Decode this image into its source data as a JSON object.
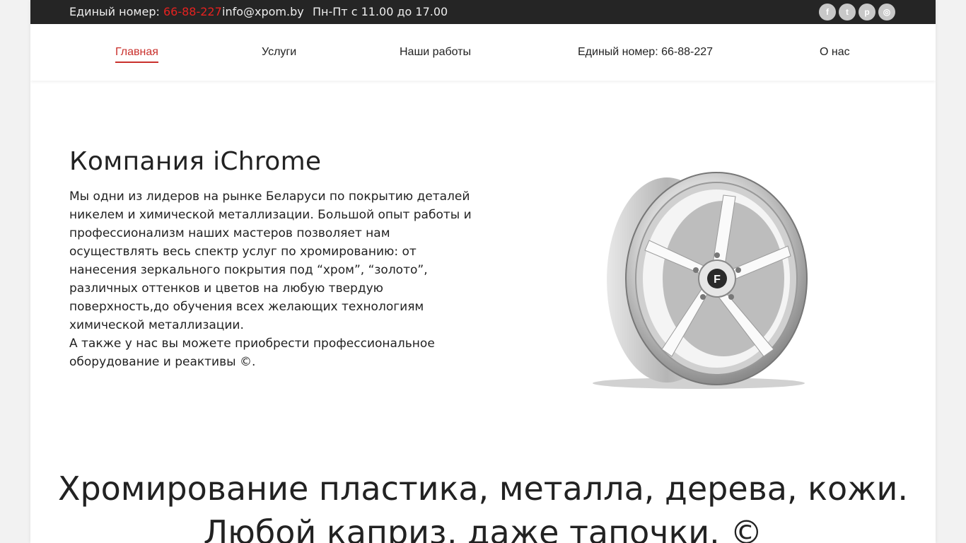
{
  "topbar": {
    "phone_label": "Единый номер:",
    "phone_number": "66-88-227",
    "email": "info@xpom.by",
    "hours": "Пн-Пт с 11.00 до 17.00",
    "social": [
      {
        "icon": "facebook-icon",
        "glyph": "f"
      },
      {
        "icon": "twitter-icon",
        "glyph": "t"
      },
      {
        "icon": "pinterest-icon",
        "glyph": "p"
      },
      {
        "icon": "instagram-icon",
        "glyph": "◎"
      }
    ]
  },
  "nav": {
    "items": [
      {
        "label": "Главная",
        "active": true
      },
      {
        "label": "Услуги"
      },
      {
        "label": "Наши работы"
      },
      {
        "label": "Единый номер: 66-88-227"
      },
      {
        "label": "О нас"
      }
    ]
  },
  "main": {
    "title": "Компания iChrome",
    "paragraph1": "Мы одни из лидеров на рынке Беларуси по покрытию деталей никелем и химической металлизации. Большой опыт работы и профессионализм наших мастеров позволяет нам осуществлять весь спектр услуг по хромированию: от нанесения зеркального покрытия под “хром”, “золото”, различных оттенков и цветов на любую твердую поверхность,до обучения всех желающих технологиям химической металлизации.",
    "paragraph2": "А также у нас вы можете приобрести профессиональное оборудование и реактивы ©.",
    "image_logo_letter": "F"
  },
  "tagline": {
    "line1": "Хромирование пластика, металла, дерева, кожи.",
    "line2": "Любой каприз, даже тапочки. ©"
  },
  "colors": {
    "accent": "#e52220",
    "topbar_bg": "#252525"
  }
}
